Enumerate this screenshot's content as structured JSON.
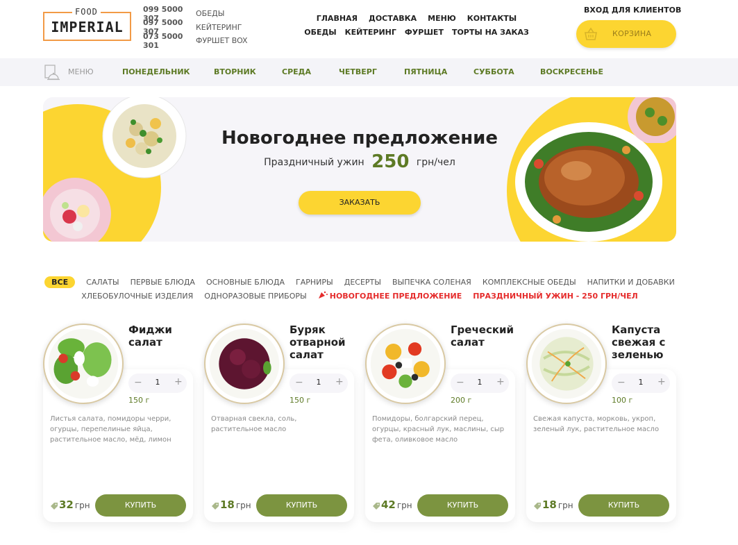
{
  "logo": {
    "top_word": "FOOD",
    "main_word": "IMPERIAL"
  },
  "phones": [
    {
      "number": "099 5000 307",
      "label": "ОБЕДЫ"
    },
    {
      "number": "097 5000 307",
      "label": "КЕЙТЕРИНГ"
    },
    {
      "number": "073 5000 301",
      "label": "ФУРШЕТ BOX"
    }
  ],
  "nav": {
    "row1": [
      "ГЛАВНАЯ",
      "ДОСТАВКА",
      "МЕНЮ",
      "КОНТАКТЫ"
    ],
    "row2": [
      "ОБЕДЫ",
      "КЕЙТЕРИНГ",
      "ФУРШЕТ",
      "ТОРТЫ НА ЗАКАЗ"
    ]
  },
  "header": {
    "login": "ВХОД ДЛЯ КЛИЕНТОВ",
    "cart": "КОРЗИНА",
    "cart_icon": "basket-icon"
  },
  "daybar": {
    "menu_label": "МЕНЮ",
    "menu_icon": "menu-cloche-icon",
    "days": [
      "ПОНЕДЕЛЬНИК",
      "ВТОРНИК",
      "СРЕДА",
      "ЧЕТВЕРГ",
      "ПЯТНИЦА",
      "СУББОТА",
      "ВОСКРЕСЕНЬЕ"
    ]
  },
  "banner": {
    "title": "Новогоднее предложение",
    "sub_before": "Праздничный ужин",
    "price": "250",
    "sub_after": "грн/чел",
    "button": "ЗАКАЗАТЬ"
  },
  "categories": {
    "row1": [
      "ВСЕ",
      "САЛАТЫ",
      "ПЕРВЫЕ БЛЮДА",
      "ОСНОВНЫЕ БЛЮДА",
      "ГАРНИРЫ",
      "ДЕСЕРТЫ",
      "ВЫПЕЧКА СОЛЕНАЯ",
      "КОМПЛЕКСНЫЕ ОБЕДЫ",
      "НАПИТКИ И ДОБАВКИ"
    ],
    "row2": [
      "ХЛЕБОБУЛОЧНЫЕ ИЗДЕЛИЯ",
      "ОДНОРАЗОВЫЕ ПРИБОРЫ",
      "НОВОГОДНЕЕ ПРЕДЛОЖЕНИЕ",
      "ПРАЗДНИЧНЫЙ УЖИН - 250 ГРН/ЧЕЛ"
    ]
  },
  "products": [
    {
      "name": "Фиджи салат",
      "qty": "1",
      "weight": "150 г",
      "desc": "Листья салата, помидоры черри, огурцы, перепелиные яйца, растительное масло, мёд, лимон",
      "price": "32",
      "currency": "грн",
      "buy": "КУПИТЬ"
    },
    {
      "name": "Буряк отварной салат",
      "qty": "1",
      "weight": "150 г",
      "desc": "Отварная свекла, соль, растительное масло",
      "price": "18",
      "currency": "грн",
      "buy": "КУПИТЬ"
    },
    {
      "name": "Греческий салат",
      "qty": "1",
      "weight": "200 г",
      "desc": "Помидоры, болгарский перец, огурцы, красный лук, маслины, сыр фета, оливковое масло",
      "price": "42",
      "currency": "грн",
      "buy": "КУПИТЬ"
    },
    {
      "name": "Капуста свежая с зеленью",
      "qty": "1",
      "weight": "100 г",
      "desc": "Свежая капуста, морковь, укроп, зеленый лук, растительное масло",
      "price": "18",
      "currency": "грн",
      "buy": "КУПИТЬ"
    }
  ],
  "colors": {
    "accent_yellow": "#fcd531",
    "brand_green": "#5d7a25",
    "button_green": "#7c9440",
    "promo_red": "#e52d2d",
    "logo_orange": "#f29a46"
  }
}
